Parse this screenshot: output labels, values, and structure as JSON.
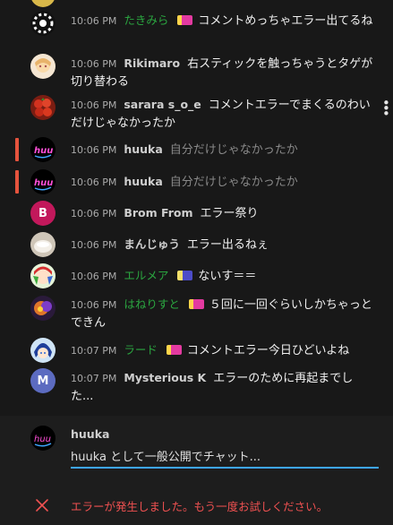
{
  "chat": {
    "messages": [
      {
        "time": "10:06 PM",
        "author": "たきみら",
        "member": true,
        "badge": true,
        "text": "コメントめっちゃエラー出てるね"
      },
      {
        "time": "10:06 PM",
        "author": "Rikimaro",
        "member": false,
        "badge": false,
        "text": "右スティックを触っちゃうとタゲが切り替わる"
      },
      {
        "time": "10:06 PM",
        "author": "sarara s_o_e",
        "member": false,
        "badge": false,
        "text": "コメントエラーでまくるのわいだけじゃなかったか"
      },
      {
        "time": "10:06 PM",
        "author": "huuka",
        "member": false,
        "badge": false,
        "text": "自分だけじゃなかったか",
        "deleted": true
      },
      {
        "time": "10:06 PM",
        "author": "huuka",
        "member": false,
        "badge": false,
        "text": "自分だけじゃなかったか",
        "deleted": true
      },
      {
        "time": "10:06 PM",
        "author": "Brom From",
        "member": false,
        "badge": false,
        "text": "エラー祭り"
      },
      {
        "time": "10:06 PM",
        "author": "まんじゅう",
        "member": false,
        "badge": false,
        "text": "エラー出るねぇ"
      },
      {
        "time": "10:06 PM",
        "author": "エルメア",
        "member": true,
        "badge": true,
        "text": "ないす＝＝"
      },
      {
        "time": "10:06 PM",
        "author": "はねりすと",
        "member": true,
        "badge": true,
        "text": "５回に一回ぐらいしかちゃっとできん"
      },
      {
        "time": "10:07 PM",
        "author": "ラード",
        "member": true,
        "badge": true,
        "text": "コメントエラー今日ひどいよね"
      },
      {
        "time": "10:07 PM",
        "author": "Mysterious K",
        "member": false,
        "badge": false,
        "text": "エラーのために再起までした..."
      }
    ],
    "avatar_letters": {
      "brom": "B",
      "mysterious": "M"
    },
    "colors": {
      "member_name": "#2ba640",
      "deleted_marker": "#e5533d",
      "error": "#f05151",
      "input_underline": "#3ea6ff"
    }
  },
  "composer": {
    "user_name": "huuka",
    "placeholder": "huuka として一般公開でチャット...",
    "error_text": "エラーが発生しました。もう一度お試しください。"
  }
}
